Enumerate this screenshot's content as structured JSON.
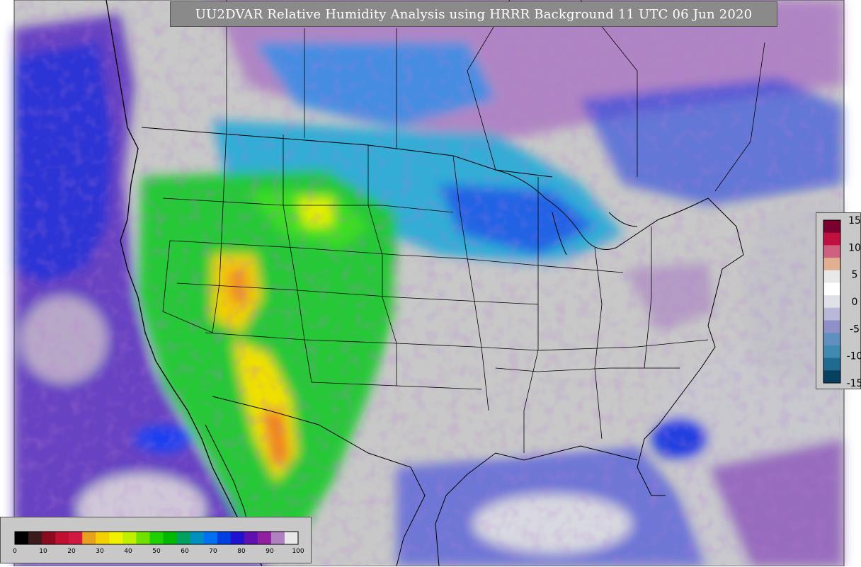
{
  "title": "UU2DVAR Relative Humidity Analysis using HRRR Background 11 UTC 06 Jun 2020",
  "rh_colorbar": {
    "ticks": [
      "0",
      "10",
      "20",
      "30",
      "40",
      "50",
      "60",
      "70",
      "80",
      "90",
      "100"
    ],
    "colors": [
      "#000000",
      "#3a1a1a",
      "#8b0a1e",
      "#c01030",
      "#d01840",
      "#e8a020",
      "#f4d000",
      "#f0f000",
      "#c0f000",
      "#70e000",
      "#20d000",
      "#00b800",
      "#00a060",
      "#0090c0",
      "#0070f0",
      "#0040e0",
      "#2010d0",
      "#6010b0",
      "#9020a0",
      "#b080c0",
      "#e8e8e8"
    ]
  },
  "diff_colorbar": {
    "ticks": [
      "15",
      "10",
      "5",
      "0",
      "-5",
      "-10",
      "-15"
    ],
    "colors": [
      "#7a0030",
      "#c01040",
      "#d06080",
      "#e0b090",
      "#e8e8e8",
      "#ffffff",
      "#e0e0e8",
      "#b8b8d8",
      "#9090c8",
      "#6090c0",
      "#408ab0",
      "#206a90",
      "#084060"
    ]
  },
  "palette": {
    "background_gray": "#c8c8c8",
    "ocean_blue": "#0a2fe0",
    "purple": "#7a10b0",
    "green": "#20c020",
    "yellow": "#f0e000",
    "orange": "#f09020",
    "red": "#c01040"
  }
}
